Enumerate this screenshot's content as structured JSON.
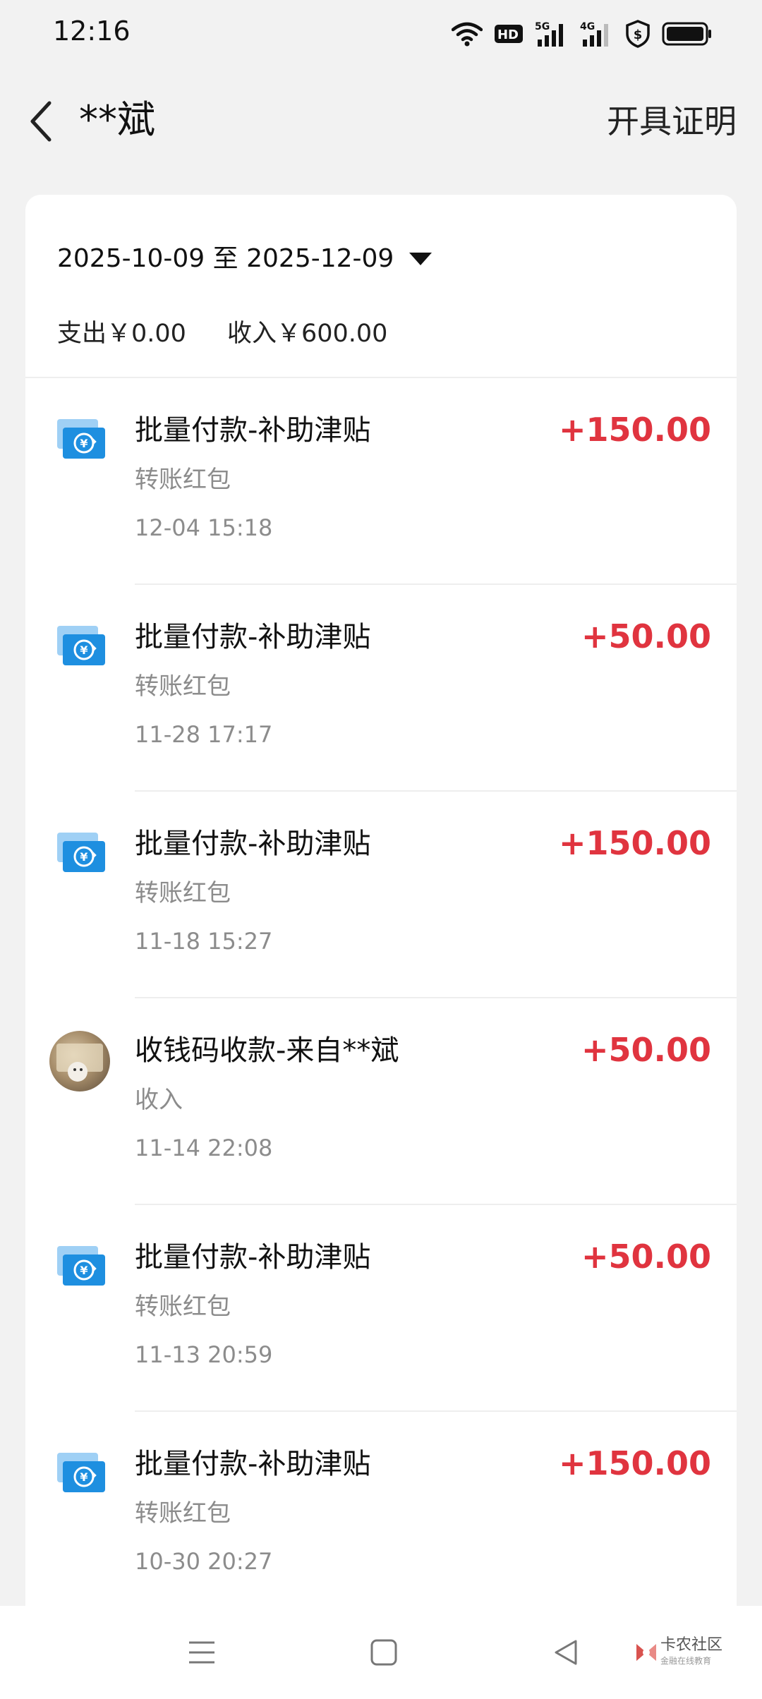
{
  "status_bar": {
    "time": "12:16",
    "icons": [
      "wifi-icon",
      "hd-icon",
      "signal-5g-icon",
      "signal-4g-icon",
      "shield-dollar-icon",
      "battery-icon"
    ]
  },
  "header": {
    "title": "**斌",
    "action_label": "开具证明"
  },
  "filter": {
    "date_range": "2025-10-09 至 2025-12-09"
  },
  "summary": {
    "expense": "支出￥0.00",
    "income": "收入￥600.00"
  },
  "transactions": [
    {
      "title": "批量付款-补助津贴",
      "subtitle": "转账红包",
      "time": "12-04 15:18",
      "amount": "+150.00",
      "icon": "transfer-icon"
    },
    {
      "title": "批量付款-补助津贴",
      "subtitle": "转账红包",
      "time": "11-28 17:17",
      "amount": "+50.00",
      "icon": "transfer-icon"
    },
    {
      "title": "批量付款-补助津贴",
      "subtitle": "转账红包",
      "time": "11-18 15:27",
      "amount": "+150.00",
      "icon": "transfer-icon"
    },
    {
      "title": "收钱码收款-来自**斌",
      "subtitle": "收入",
      "time": "11-14 22:08",
      "amount": "+50.00",
      "icon": "avatar"
    },
    {
      "title": "批量付款-补助津贴",
      "subtitle": "转账红包",
      "time": "11-13 20:59",
      "amount": "+50.00",
      "icon": "transfer-icon"
    },
    {
      "title": "批量付款-补助津贴",
      "subtitle": "转账红包",
      "time": "10-30 20:27",
      "amount": "+150.00",
      "icon": "transfer-icon"
    }
  ],
  "watermark": {
    "text": "卡农社区",
    "subtext": "金融在线教育"
  },
  "colors": {
    "amount_income": "#e0343f",
    "icon_blue": "#1e8fe0",
    "background": "#f2f2f2"
  }
}
